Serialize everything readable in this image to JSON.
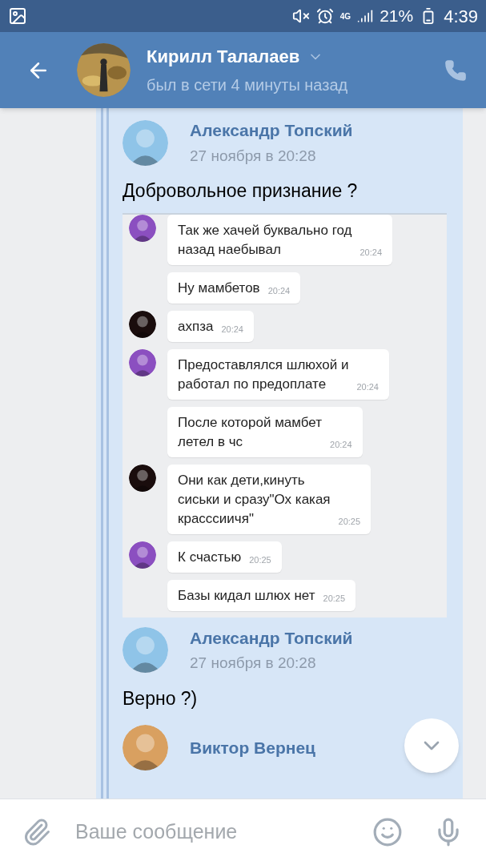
{
  "status_bar": {
    "network": "4G",
    "battery": "21%",
    "time": "4:39"
  },
  "header": {
    "name": "Кирилл Талалаев",
    "status": "был в сети 4 минуты назад"
  },
  "posts": [
    {
      "author": "Александр Топский",
      "date": "27 ноября в 20:28",
      "text": "Добровольное признание ?",
      "color": "#8fc4e8",
      "screenshot": [
        {
          "color": "#8b4fc0",
          "text": "Так же хачей буквально год\nназад наебывал",
          "time": "20:24"
        },
        {
          "text": "Ну мамбетов",
          "time": "20:24"
        },
        {
          "color": "#1a0d0d",
          "text": "ахпза",
          "time": "20:24"
        },
        {
          "color": "#8b4fc0",
          "text": "Предоставлялся шлюхой и\nработал по предоплате",
          "time": "20:24"
        },
        {
          "text": "После которой мамбет\nлетел в чс",
          "time": "20:24"
        },
        {
          "color": "#1a0d0d",
          "text": "Они как дети,кинуть\nсиськи и сразу\"Ох какая\nкрасссиичя\"",
          "time": "20:25"
        },
        {
          "color": "#8b4fc0",
          "text": "К счастью",
          "time": "20:25"
        },
        {
          "text": "Базы кидал шлюх нет",
          "time": "20:25"
        }
      ]
    },
    {
      "author": "Александр Топский",
      "date": "27 ноября в 20:28",
      "text": "Верно ?)",
      "color": "#8fc4e8"
    },
    {
      "author": "Виктор Вернец",
      "color": "#d9a060"
    }
  ],
  "composer": {
    "placeholder": "Ваше сообщение"
  }
}
